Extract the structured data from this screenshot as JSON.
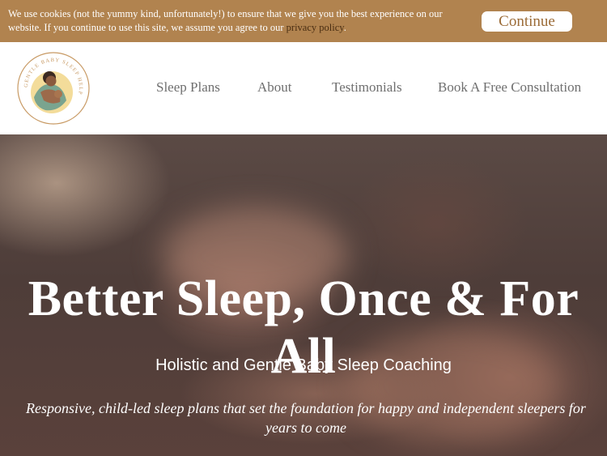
{
  "cookie_bar": {
    "text": "We use cookies (not the yummy kind, unfortunately!) to ensure that we give you the best experience on our website. If you continue to use this site, we assume you agree to our ",
    "link": "privacy policy",
    "suffix": ".",
    "continue_label": "Continue"
  },
  "logo": {
    "ring_text": "GENTLE BABY SLEEP HELP"
  },
  "nav": {
    "items": [
      {
        "label": "Sleep Plans"
      },
      {
        "label": "About"
      },
      {
        "label": "Testimonials"
      },
      {
        "label": "Book A Free Consultation"
      }
    ]
  },
  "hero": {
    "title": "Better Sleep, Once & For All",
    "subtitle": "Holistic and Gentle Baby Sleep Coaching",
    "description": "Responsive, child-led sleep plans that set the foundation for happy and independent sleepers for years to come"
  },
  "colors": {
    "cookie_bar": "#b1834f",
    "nav_text": "#6f6f6f",
    "logo_ring": "#c89a64"
  }
}
